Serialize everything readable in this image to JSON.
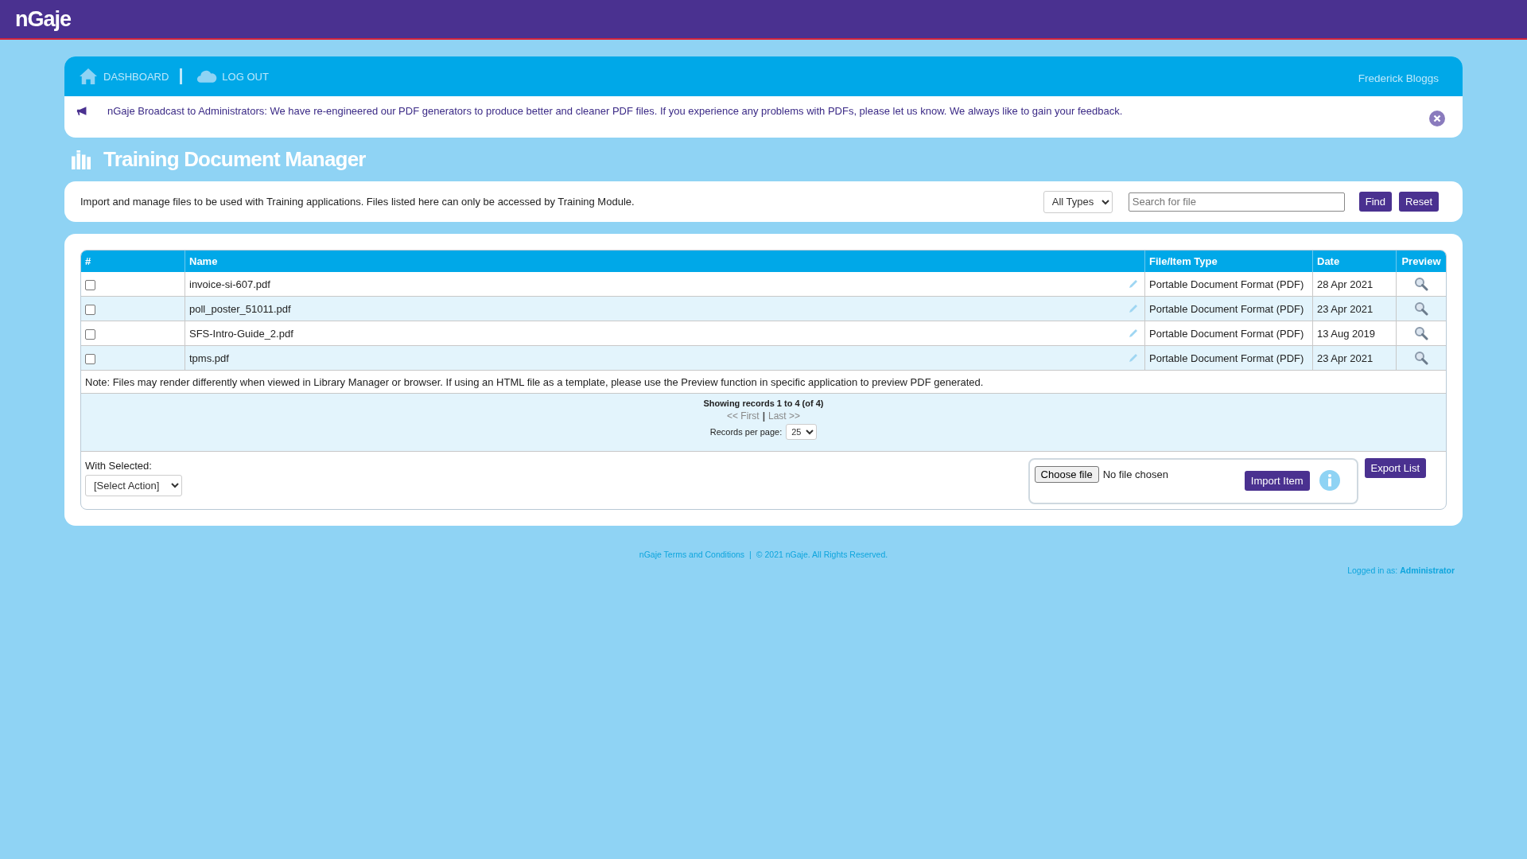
{
  "header": {
    "logo": "nGaje"
  },
  "nav": {
    "items": [
      {
        "kind": "home",
        "label": "DASHBOARD"
      },
      {
        "kind": "cloud",
        "label": "LOG OUT"
      }
    ],
    "user": "Frederick Bloggs"
  },
  "broadcast": {
    "text": "nGaje Broadcast to Administrators: We have re-engineered our PDF generators to produce better and cleaner PDF files. If you experience any problems with PDFs, please let us know. We always like to gain your feedback."
  },
  "page_title": "Training Document Manager",
  "intro": {
    "text": "Import and manage files to be used with Training applications. Files listed here can only be accessed by Training Module.",
    "type_filter": "All Types",
    "search": {
      "placeholder": "Search for file"
    },
    "buttons": [
      "Find",
      "Reset"
    ]
  },
  "table": {
    "columns": [
      "#",
      "Name",
      "File/Item Type",
      "Date",
      "Preview"
    ],
    "rows": [
      {
        "checked": false,
        "name": "invoice-si-607.pdf",
        "type": "Portable Document Format (PDF)",
        "date": "28 Apr 2021"
      },
      {
        "checked": false,
        "name": "poll_poster_51011.pdf",
        "type": "Portable Document Format (PDF)",
        "date": "23 Apr 2021"
      },
      {
        "checked": false,
        "name": "SFS-Intro-Guide_2.pdf",
        "type": "Portable Document Format (PDF)",
        "date": "13 Aug 2019"
      },
      {
        "checked": false,
        "name": "tpms.pdf",
        "type": "Portable Document Format (PDF)",
        "date": "23 Apr 2021"
      }
    ],
    "note": "Note: Files may render differently when viewed in Library Manager or browser. If using an HTML file as a template, please use the Preview function in specific application to preview PDF generated."
  },
  "pagination": {
    "summary": "Showing records 1 to 4 (of 4)",
    "first": "<< First",
    "separator": "|",
    "last": "Last >>",
    "per_page_label": "Records per page:",
    "per_page": "25"
  },
  "actions": {
    "with_selected_label": "With Selected:",
    "action_select": "[Select Action]",
    "choose_file": "Choose file",
    "file_status": "No file chosen",
    "import": "Import Item",
    "export": "Export List"
  },
  "footer": {
    "terms": "nGaje Terms and Conditions",
    "separator": "|",
    "copyright": "© 2021 nGaje. All Rights Reserved.",
    "logged_in": "Logged in as: **Administrator**"
  }
}
